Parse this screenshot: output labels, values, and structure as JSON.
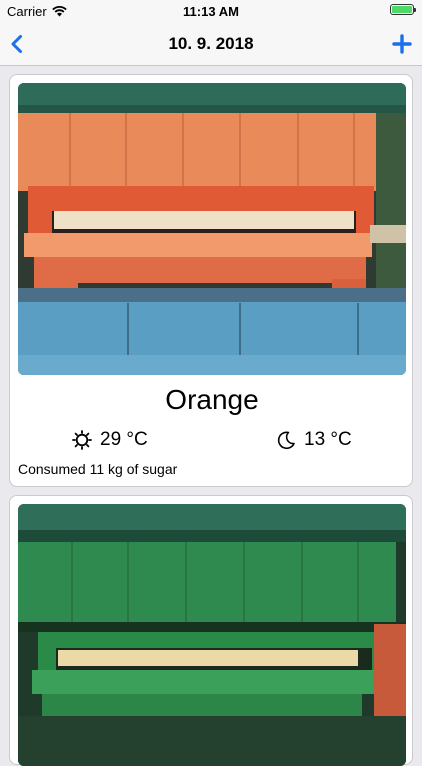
{
  "status_bar": {
    "carrier": "Carrier",
    "time": "11:13 AM",
    "battery_level": 1.0
  },
  "nav": {
    "title": "10. 9. 2018",
    "back_icon": "chevron-left-icon",
    "add_icon": "plus-icon"
  },
  "colors": {
    "accent": "#1b6fe8",
    "background": "#e9e9ee"
  },
  "cards": [
    {
      "name": "Orange",
      "day_temp": "29 °C",
      "night_temp": "13 °C",
      "consumed": "Consumed 11 kg of sugar",
      "day_icon": "sun-icon",
      "night_icon": "moon-icon"
    },
    {
      "name": "",
      "day_temp": "",
      "night_temp": "",
      "consumed": ""
    }
  ]
}
